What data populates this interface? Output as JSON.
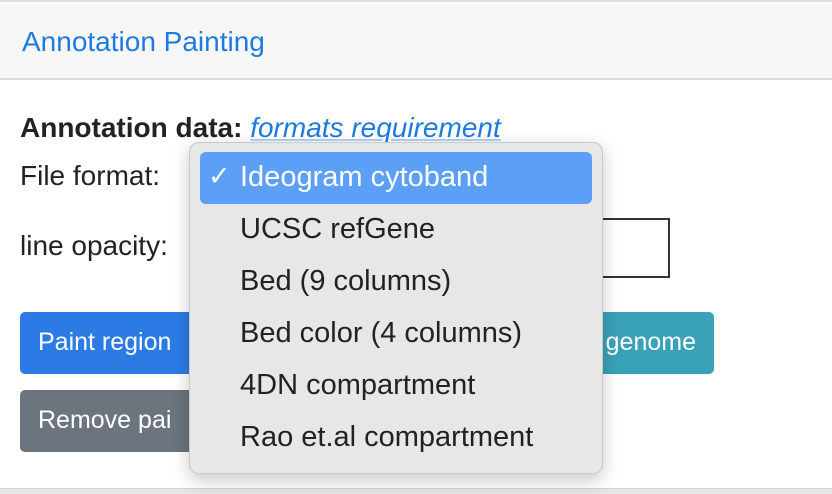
{
  "header": {
    "title": "Annotation Painting"
  },
  "form": {
    "annotation_label": "Annotation data:",
    "formats_link": "formats requirement",
    "file_format_label": "File format:",
    "line_opacity_label": "line opacity:",
    "line_opacity_value": ""
  },
  "buttons": {
    "paint_region": "Paint region",
    "paint_genome": "genome",
    "remove_paint": "Remove pai"
  },
  "file_format_dropdown": {
    "check_mark": "✓",
    "selected": "Ideogram cytoband",
    "options": [
      "Ideogram cytoband",
      "UCSC refGene",
      "Bed (9 columns)",
      "Bed color (4 columns)",
      "4DN compartment",
      "Rao et.al compartment"
    ]
  },
  "colors": {
    "primary": "#2c7be5",
    "info": "#3aa2b8",
    "secondary": "#6c757d",
    "link": "#1f7ae0",
    "selection": "#5b9ff7"
  }
}
